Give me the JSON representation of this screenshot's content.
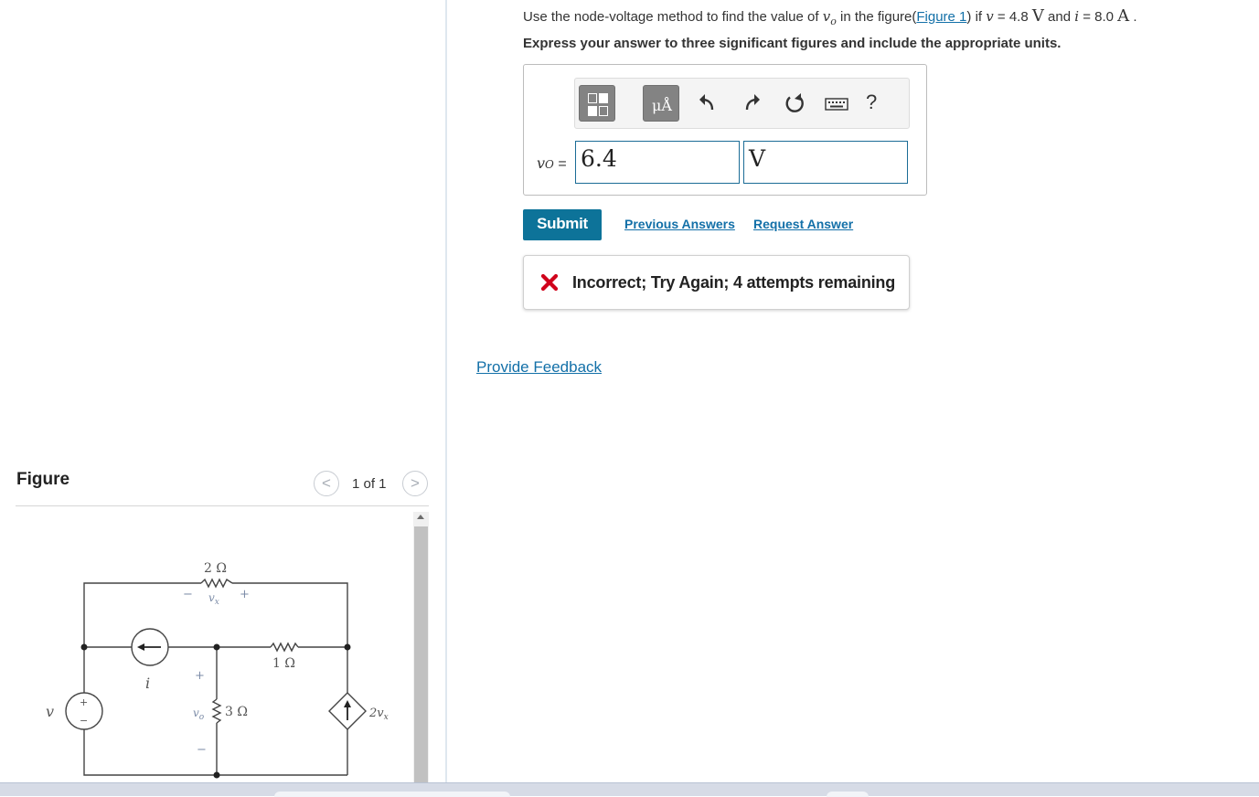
{
  "problem": {
    "text_before": "Use the node-voltage method to find the value of ",
    "var_vo": "v",
    "var_vo_sub": "o",
    "text_middle": " in the figure(",
    "figure_link": "Figure 1",
    "text_if": ") if ",
    "var_v": "v",
    "eq1": " = 4.8 ",
    "unit_v": "V",
    "text_and": " and ",
    "var_i": "i",
    "eq2": " = 8.0 ",
    "unit_a": "A",
    "period": " .",
    "instructions": "Express your answer to three significant figures and include the appropriate units."
  },
  "toolbar": {
    "templates_icon": "templates-icon",
    "units_button": "μÅ",
    "undo_icon": "undo-icon",
    "redo_icon": "redo-icon",
    "reset_icon": "reset-icon",
    "keyboard_icon": "keyboard-icon",
    "help": "?"
  },
  "answer": {
    "label_var": "v",
    "label_sub": "O",
    "label_eq": " =",
    "value": "6.4",
    "unit": "V"
  },
  "actions": {
    "submit": "Submit",
    "previous_answers": "Previous Answers",
    "request_answer": "Request Answer"
  },
  "feedback": {
    "icon": "x-icon",
    "color": "#d0021b",
    "message": "Incorrect; Try Again; 4 attempts remaining"
  },
  "provide_feedback": "Provide Feedback",
  "figure": {
    "title": "Figure",
    "counter": "1 of 1",
    "prev": "<",
    "next": ">",
    "labels": {
      "r2": "2 Ω",
      "r1": "1 Ω",
      "r3": "3 Ω",
      "vx": "v",
      "vx_sub": "x",
      "vo": "v",
      "vo_sub": "o",
      "src_v": "v",
      "src_i": "i",
      "dep": "2v",
      "dep_sub": "x",
      "plus": "+",
      "minus": "−"
    }
  },
  "colors": {
    "link": "#1370a8",
    "submit_bg": "#0d7399",
    "input_border": "#1b6c96"
  }
}
